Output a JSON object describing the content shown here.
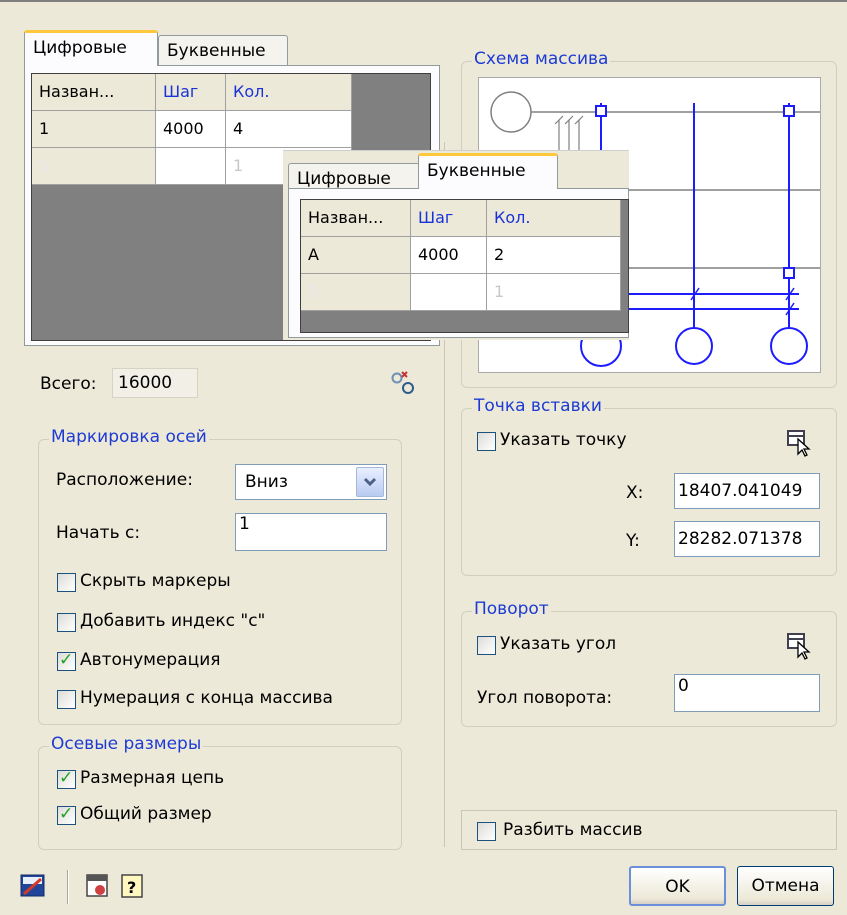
{
  "tabs": {
    "digital": "Цифровые",
    "letter": "Буквенные"
  },
  "grid_columns": {
    "name": "Назван...",
    "step": "Шаг",
    "count": "Кол."
  },
  "digital_grid": {
    "rows": [
      {
        "name": "1",
        "step": "4000",
        "count": "4"
      }
    ],
    "new_row": {
      "name": "5",
      "count": "1"
    }
  },
  "letter_grid": {
    "rows": [
      {
        "name": "A",
        "step": "4000",
        "count": "2"
      }
    ],
    "new_row": {
      "name": "B",
      "count": "1"
    }
  },
  "total": {
    "label": "Всего:",
    "value": "16000"
  },
  "axis_marking": {
    "title": "Маркировка осей",
    "position_label": "Расположение:",
    "position_value": "Вниз",
    "start_label": "Начать с:",
    "start_value": "1",
    "hide_markers": {
      "label": "Скрыть маркеры",
      "checked": false
    },
    "add_index": {
      "label": "Добавить индекс \"с\"",
      "checked": false
    },
    "auto_numbering": {
      "label": "Автонумерация",
      "checked": true
    },
    "reverse_numbering": {
      "label": "Нумерация с конца массива",
      "checked": false
    }
  },
  "axis_dimensions": {
    "title": "Осевые размеры",
    "chain": {
      "label": "Размерная цепь",
      "checked": true
    },
    "overall": {
      "label": "Общий размер",
      "checked": true
    }
  },
  "scheme": {
    "title": "Схема массива"
  },
  "insertion_point": {
    "title": "Точка вставки",
    "pick_label": "Указать точку",
    "x_label": "X:",
    "x_value": "18407.041049",
    "y_label": "Y:",
    "y_value": "28282.071378"
  },
  "rotation": {
    "title": "Поворот",
    "pick_label": "Указать угол",
    "angle_label": "Угол поворота:",
    "angle_value": "0"
  },
  "explode": {
    "label": "Разбить массив",
    "checked": false
  },
  "buttons": {
    "ok": "OK",
    "cancel": "Отмена"
  }
}
